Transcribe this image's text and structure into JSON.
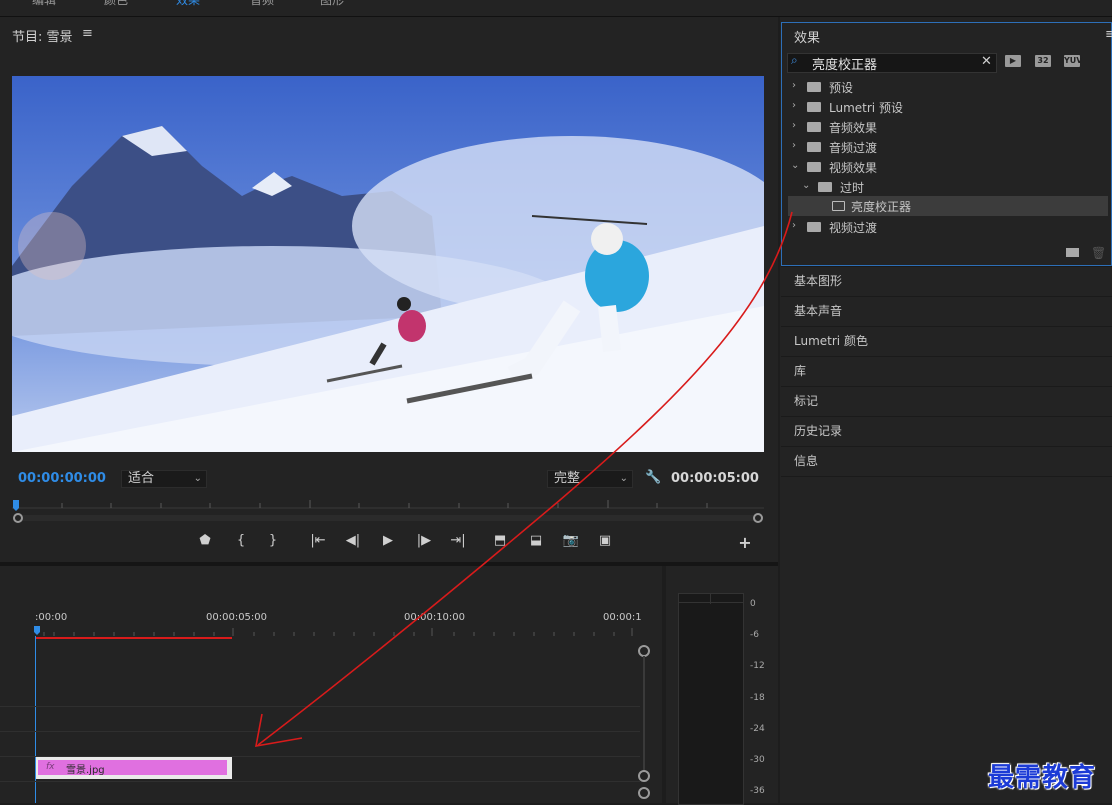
{
  "top_tabs": [
    "编辑",
    "颜色",
    "效果",
    "音频",
    "图形"
  ],
  "program": {
    "title": "节目: 雪景",
    "menu_icon": "hamburger-menu-icon",
    "current_timecode": "00:00:00:00",
    "fit_value": "适合",
    "quality_value": "完整",
    "duration_timecode": "00:00:05:00"
  },
  "transport": {
    "buttons": [
      "add-marker-icon",
      "mark-in-icon",
      "mark-out-icon",
      "go-to-in-icon",
      "step-back-icon",
      "play-icon",
      "step-forward-icon",
      "go-to-out-icon",
      "lift-icon",
      "extract-icon",
      "export-frame-icon",
      "compare-icon"
    ],
    "add_label": "+"
  },
  "timeline": {
    "ruler_labels": [
      ":00:00",
      "00:00:05:00",
      "00:00:10:00",
      "00:00:1"
    ],
    "clip": {
      "fx": "fx",
      "label": "雪景.jpg",
      "color": "#e070e0"
    }
  },
  "audio_meter": {
    "db_labels": [
      "0",
      "-6",
      "-12",
      "-18",
      "-24",
      "-30",
      "-36"
    ]
  },
  "effects_panel": {
    "title": "效果",
    "search_value": "亮度校正器",
    "filter_badges": [
      "32",
      "YUV"
    ],
    "tree": [
      {
        "label": "预设",
        "depth": 0,
        "expanded": false
      },
      {
        "label": "Lumetri 预设",
        "depth": 0,
        "expanded": false
      },
      {
        "label": "音频效果",
        "depth": 0,
        "expanded": false
      },
      {
        "label": "音频过渡",
        "depth": 0,
        "expanded": false
      },
      {
        "label": "视频效果",
        "depth": 0,
        "expanded": true
      },
      {
        "label": "过时",
        "depth": 1,
        "expanded": true
      },
      {
        "label": "亮度校正器",
        "depth": 2,
        "selected": true
      },
      {
        "label": "视频过渡",
        "depth": 0,
        "expanded": false
      }
    ]
  },
  "side_panels": [
    "基本图形",
    "基本声音",
    "Lumetri 颜色",
    "库",
    "标记",
    "历史记录",
    "信息"
  ],
  "watermark": "最需教育",
  "colors": {
    "accent_blue": "#2f8ce6",
    "annotation_red": "#d81b1b",
    "clip_pink": "#e070e0"
  }
}
